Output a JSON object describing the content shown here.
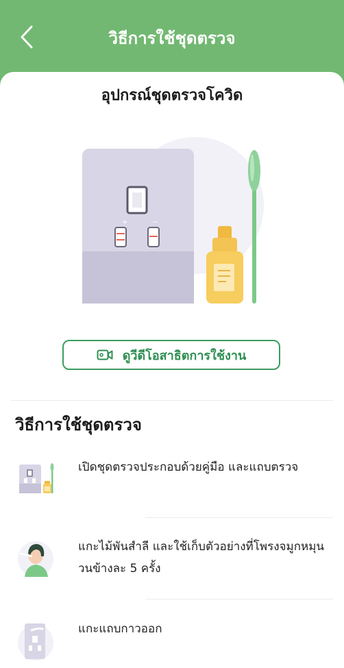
{
  "header": {
    "title": "วิธีการใช้ชุดตรวจ",
    "back_icon": "chevron-left-icon"
  },
  "kit": {
    "title": "อุปกรณ์ชุดตรวจโควิด"
  },
  "video_button": {
    "label": "ดูวีดีโอสาธิตการใช้งาน",
    "icon": "video-camera-icon"
  },
  "instructions": {
    "title": "วิธีการใช้ชุดตรวจ",
    "steps": [
      {
        "text": "เปิดชุดตรวจประกอบด้วยคู่มือ และแถบตรวจ",
        "icon": "test-kit-icon"
      },
      {
        "text": "แกะไม้พันสำลี และใช้เก็บตัวอย่างที่โพรงจมูกหมุนวนข้างละ 5 ครั้ง",
        "icon": "nose-swab-icon"
      },
      {
        "text": "แกะแถบกาวออก",
        "icon": "test-cassette-icon"
      }
    ]
  },
  "colors": {
    "header": "#72b872",
    "accent": "#3c9c5e",
    "swab": "#7cc987",
    "bottle": "#f3c453"
  }
}
